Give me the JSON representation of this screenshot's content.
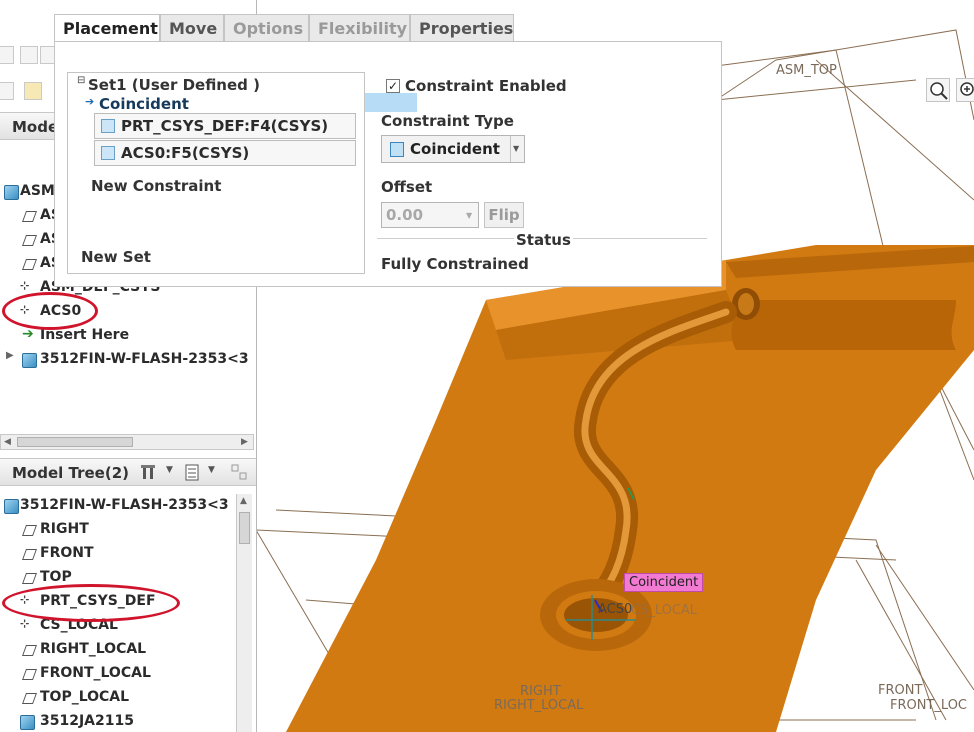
{
  "dashboard": {
    "tabs": [
      {
        "label": "Placement",
        "state": "active"
      },
      {
        "label": "Move",
        "state": "normal"
      },
      {
        "label": "Options",
        "state": "disabled"
      },
      {
        "label": "Flexibility",
        "state": "disabled"
      },
      {
        "label": "Properties",
        "state": "normal"
      }
    ],
    "set_title": "Set1 (User Defined )",
    "constraint_row": "Coincident",
    "references": [
      "PRT_CSYS_DEF:F4(CSYS)",
      "ACS0:F5(CSYS)"
    ],
    "new_constraint": "New Constraint",
    "new_set": "New Set",
    "constraint_enabled_label": "Constraint Enabled",
    "constraint_enabled_checked": "✓",
    "constraint_type_label": "Constraint Type",
    "constraint_type_value": "Coincident",
    "offset_label": "Offset",
    "offset_value": "0.00",
    "flip_label": "Flip",
    "status_label": "Status",
    "status_value": "Fully Constrained"
  },
  "model_tree_1": {
    "header": "Mode",
    "items": [
      {
        "label": "ASM",
        "icon": "assembly-icon"
      },
      {
        "label": "AS",
        "icon": "datum-plane-icon"
      },
      {
        "label": "AS",
        "icon": "datum-plane-icon"
      },
      {
        "label": "AS",
        "icon": "datum-plane-icon"
      },
      {
        "label": "ASM_DEF_CSYS",
        "icon": "csys-icon"
      },
      {
        "label": "ACS0",
        "icon": "csys-icon"
      },
      {
        "label": "Insert Here",
        "icon": "insert-arrow-icon"
      },
      {
        "label": "3512FIN-W-FLASH-2353<3",
        "icon": "part-icon"
      }
    ]
  },
  "model_tree_2": {
    "header": "Model Tree(2)",
    "items": [
      {
        "label": "3512FIN-W-FLASH-2353<3",
        "icon": "part-icon"
      },
      {
        "label": "RIGHT",
        "icon": "datum-plane-icon"
      },
      {
        "label": "FRONT",
        "icon": "datum-plane-icon"
      },
      {
        "label": "TOP",
        "icon": "datum-plane-icon"
      },
      {
        "label": "PRT_CSYS_DEF",
        "icon": "csys-icon"
      },
      {
        "label": "CS_LOCAL",
        "icon": "csys-icon"
      },
      {
        "label": "RIGHT_LOCAL",
        "icon": "datum-plane-icon"
      },
      {
        "label": "FRONT_LOCAL",
        "icon": "datum-plane-icon"
      },
      {
        "label": "TOP_LOCAL",
        "icon": "datum-plane-icon"
      },
      {
        "label": "3512JA2115",
        "icon": "part-icon"
      }
    ]
  },
  "viewport": {
    "annotation": "Coincident",
    "datum_labels": {
      "asm_top": "ASM_TOP",
      "acs0": "ACS0",
      "acs0_overlay": "CS_LOCAL",
      "right": "RIGHT",
      "right_local": "RIGHT_LOCAL",
      "front": "FRONT",
      "front_local": "FRONT_LOC"
    },
    "colors": {
      "part": "#d27a12",
      "part_shadow": "#a85c05",
      "datum": "#8a6e52",
      "highlight": "#f37ad2"
    }
  }
}
